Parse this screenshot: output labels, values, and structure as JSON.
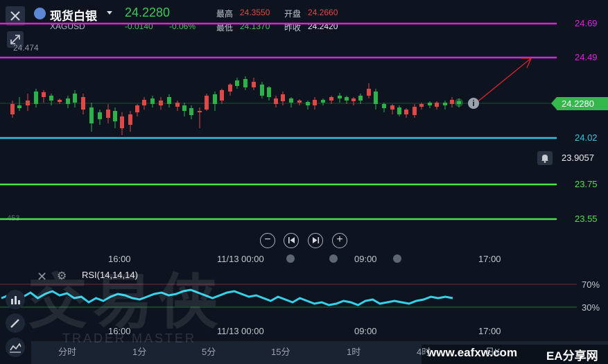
{
  "header": {
    "title": "现货白银",
    "symbol": "XAGUSD",
    "price": "24.2280",
    "change": "-0.0140",
    "change_pct": "-0.06%",
    "high_label": "最高",
    "high": "24.3550",
    "open_label": "开盘",
    "open": "24.2660",
    "low_label": "最低",
    "low": "24.1370",
    "prev_label": "昨收",
    "prev": "24.2420"
  },
  "chart": {
    "left_axis_label": "24.474",
    "left_axis_label_2": "453",
    "current_price": "24.2280",
    "alert_price": "23.9057",
    "levels": [
      {
        "value": "24.69",
        "color": "#e21ee0"
      },
      {
        "value": "24.49",
        "color": "#e21ee0"
      },
      {
        "value": "24.02",
        "color": "#2fc7df"
      },
      {
        "value": "23.75",
        "color": "#4fe04a"
      },
      {
        "value": "23.55",
        "color": "#4fe04a"
      }
    ],
    "time_labels": [
      "16:00",
      "11/13 00:00",
      "09:00",
      "17:00"
    ]
  },
  "rsi": {
    "label": "RSI(14,14,14)",
    "upper": "70%",
    "lower": "30%",
    "time_labels": [
      "16:00",
      "11/13 00:00",
      "09:00",
      "17:00"
    ]
  },
  "timeframes": [
    "分时",
    "1分",
    "5分",
    "15分",
    "1时",
    "4时",
    "日K"
  ],
  "watermark": {
    "brand": "交易侠",
    "sub": "TRADER MASTER",
    "site": "www.eafxw.com",
    "site2": "EA分享网"
  },
  "colors": {
    "up": "#e04848",
    "down": "#2bb34a",
    "accent_green": "#3ec75a"
  }
}
